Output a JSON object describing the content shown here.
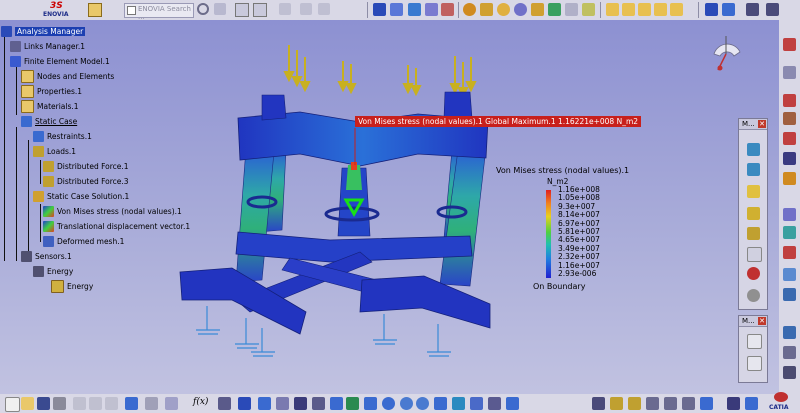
{
  "header": {
    "brand_top": "3S",
    "brand_name": "ENOVIA",
    "search_placeholder": "ENOVIA Search ..."
  },
  "tree": {
    "root": "Analysis Manager",
    "items": [
      {
        "label": "Links Manager.1"
      },
      {
        "label": "Finite Element Model.1"
      },
      {
        "label": "Nodes and Elements"
      },
      {
        "label": "Properties.1"
      },
      {
        "label": "Materials.1"
      },
      {
        "label": "Static Case"
      },
      {
        "label": "Restraints.1"
      },
      {
        "label": "Loads.1"
      },
      {
        "label": "Distributed Force.1"
      },
      {
        "label": "Distributed Force.3"
      },
      {
        "label": "Static Case Solution.1"
      },
      {
        "label": "Von Mises stress (nodal values).1"
      },
      {
        "label": "Translational displacement vector.1"
      },
      {
        "label": "Deformed mesh.1"
      },
      {
        "label": "Sensors.1"
      },
      {
        "label": "Energy"
      },
      {
        "label": "Energy"
      }
    ]
  },
  "viewport": {
    "global_max_label": "Von Mises stress (nodal values).1  Global Maximum.1  1.16221e+008 N_m2"
  },
  "legend": {
    "title": "Von Mises stress (nodal values).1",
    "unit": "N_m2",
    "values": [
      "1.16e+008",
      "1.05e+008",
      "9.3e+007",
      "8.14e+007",
      "6.97e+007",
      "5.81e+007",
      "4.65e+007",
      "3.49e+007",
      "2.32e+007",
      "1.16e+007",
      "2.93e-006"
    ],
    "footer": "On Boundary"
  },
  "panels": {
    "right_panel_title": "M...",
    "right_panel2_title": "M..."
  },
  "bottom_toolbar": {
    "fx_label": "f(x)"
  },
  "brand": {
    "catia": "CATIA"
  },
  "colors": {
    "background_top": "#8a8ed1",
    "background_bottom": "#c4c5e2",
    "selection": "#1c3fb1",
    "max_label_bg": "#c8201c",
    "mesh_blue": "#2438c8"
  }
}
